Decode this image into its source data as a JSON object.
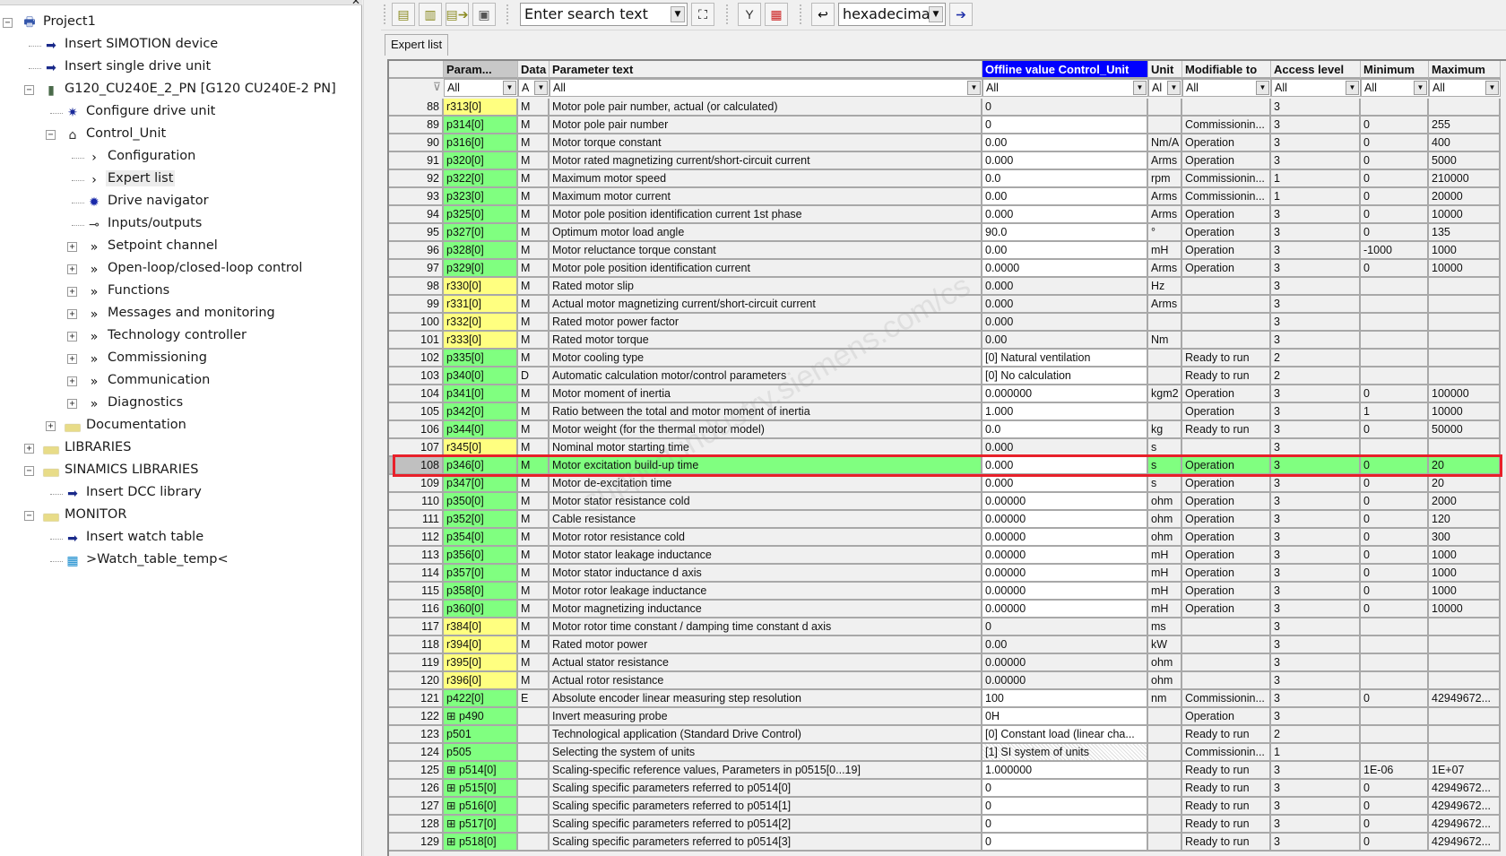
{
  "tree": [
    {
      "label": "Project1",
      "level": 0,
      "toggle": "minus",
      "icon": "project-icon"
    },
    {
      "label": "Insert SIMOTION device",
      "level": 1,
      "toggle": null,
      "icon": "insert-device-icon"
    },
    {
      "label": "Insert single drive unit",
      "level": 1,
      "toggle": null,
      "icon": "insert-device-icon"
    },
    {
      "label": "G120_CU240E_2_PN [G120 CU240E-2 PN]",
      "level": 1,
      "toggle": "minus",
      "icon": "drive-unit-icon"
    },
    {
      "label": "Configure drive unit",
      "level": 2,
      "toggle": null,
      "icon": "configure-gear-icon"
    },
    {
      "label": "Control_Unit",
      "level": 2,
      "toggle": "minus",
      "icon": "control-unit-icon"
    },
    {
      "label": "Configuration",
      "level": 3,
      "toggle": null,
      "icon": "chevron-right-icon"
    },
    {
      "label": "Expert list",
      "level": 3,
      "toggle": null,
      "icon": "chevron-right-icon",
      "selected": true
    },
    {
      "label": "Drive navigator",
      "level": 3,
      "toggle": null,
      "icon": "drive-navigator-icon"
    },
    {
      "label": "Inputs/outputs",
      "level": 3,
      "toggle": null,
      "icon": "inputs-outputs-icon"
    },
    {
      "label": "Setpoint channel",
      "level": 3,
      "toggle": "plus",
      "icon": "double-chevron-icon"
    },
    {
      "label": "Open-loop/closed-loop control",
      "level": 3,
      "toggle": "plus",
      "icon": "double-chevron-icon"
    },
    {
      "label": "Functions",
      "level": 3,
      "toggle": "plus",
      "icon": "double-chevron-icon"
    },
    {
      "label": "Messages and monitoring",
      "level": 3,
      "toggle": "plus",
      "icon": "double-chevron-icon"
    },
    {
      "label": "Technology controller",
      "level": 3,
      "toggle": "plus",
      "icon": "double-chevron-icon"
    },
    {
      "label": "Commissioning",
      "level": 3,
      "toggle": "plus",
      "icon": "double-chevron-icon"
    },
    {
      "label": "Communication",
      "level": 3,
      "toggle": "plus",
      "icon": "double-chevron-icon"
    },
    {
      "label": "Diagnostics",
      "level": 3,
      "toggle": "plus",
      "icon": "double-chevron-icon"
    },
    {
      "label": "Documentation",
      "level": 2,
      "toggle": "plus",
      "icon": "folder-icon"
    },
    {
      "label": "LIBRARIES",
      "level": 1,
      "toggle": "plus",
      "icon": "folder-icon"
    },
    {
      "label": "SINAMICS LIBRARIES",
      "level": 1,
      "toggle": "minus",
      "icon": "folder-icon"
    },
    {
      "label": "Insert DCC library",
      "level": 2,
      "toggle": null,
      "icon": "insert-device-icon"
    },
    {
      "label": "MONITOR",
      "level": 1,
      "toggle": "minus",
      "icon": "folder-icon"
    },
    {
      "label": "Insert watch table",
      "level": 2,
      "toggle": null,
      "icon": "insert-device-icon"
    },
    {
      "label": ">Watch_table_temp<",
      "level": 2,
      "toggle": null,
      "icon": "watch-table-icon"
    }
  ],
  "toolbar": {
    "search_placeholder": "Enter search text",
    "number_format": "hexadecima",
    "buttons": [
      "new-parameter-icon",
      "open-list-icon",
      "export-list-icon",
      "save-list-icon",
      "binoculars-icon",
      "filter-icon",
      "compare-icon",
      "back-arrow-icon",
      "go-icon"
    ]
  },
  "tab": "Expert list",
  "colors": {
    "readonly_param": "#ffff80",
    "writable_param": "#80ff80",
    "highlight_row": "#80ff80",
    "header_active": "#0000ff",
    "red_box": "#e8202a"
  },
  "columns": [
    "",
    "Param...",
    "Data",
    "Parameter text",
    "Offline value Control_Unit",
    "Unit",
    "Modifiable to",
    "Access level",
    "Minimum",
    "Maximum"
  ],
  "filters": [
    "",
    "All",
    "A",
    "All",
    "All",
    "Al",
    "All",
    "All",
    "All",
    "All"
  ],
  "rows": [
    {
      "n": "88",
      "param": "r313[0]",
      "data": "M",
      "text": "Motor pole pair number, actual (or calculated)",
      "value": "0",
      "unit": "",
      "mod": "",
      "access": "3",
      "min": "",
      "max": ""
    },
    {
      "n": "89",
      "param": "p314[0]",
      "data": "M",
      "text": "Motor pole pair number",
      "value": "0",
      "unit": "",
      "mod": "Commissionin...",
      "access": "3",
      "min": "0",
      "max": "255"
    },
    {
      "n": "90",
      "param": "p316[0]",
      "data": "M",
      "text": "Motor torque constant",
      "value": "0.00",
      "unit": "Nm/A",
      "mod": "Operation",
      "access": "3",
      "min": "0",
      "max": "400"
    },
    {
      "n": "91",
      "param": "p320[0]",
      "data": "M",
      "text": "Motor rated magnetizing current/short-circuit current",
      "value": "0.000",
      "unit": "Arms",
      "mod": "Operation",
      "access": "3",
      "min": "0",
      "max": "5000"
    },
    {
      "n": "92",
      "param": "p322[0]",
      "data": "M",
      "text": "Maximum motor speed",
      "value": "0.0",
      "unit": "rpm",
      "mod": "Commissionin...",
      "access": "1",
      "min": "0",
      "max": "210000"
    },
    {
      "n": "93",
      "param": "p323[0]",
      "data": "M",
      "text": "Maximum motor current",
      "value": "0.00",
      "unit": "Arms",
      "mod": "Commissionin...",
      "access": "1",
      "min": "0",
      "max": "20000"
    },
    {
      "n": "94",
      "param": "p325[0]",
      "data": "M",
      "text": "Motor pole position identification current 1st phase",
      "value": "0.000",
      "unit": "Arms",
      "mod": "Operation",
      "access": "3",
      "min": "0",
      "max": "10000"
    },
    {
      "n": "95",
      "param": "p327[0]",
      "data": "M",
      "text": "Optimum motor load angle",
      "value": "90.0",
      "unit": "°",
      "mod": "Operation",
      "access": "3",
      "min": "0",
      "max": "135"
    },
    {
      "n": "96",
      "param": "p328[0]",
      "data": "M",
      "text": "Motor reluctance torque constant",
      "value": "0.00",
      "unit": "mH",
      "mod": "Operation",
      "access": "3",
      "min": "-1000",
      "max": "1000"
    },
    {
      "n": "97",
      "param": "p329[0]",
      "data": "M",
      "text": "Motor pole position identification current",
      "value": "0.0000",
      "unit": "Arms",
      "mod": "Operation",
      "access": "3",
      "min": "0",
      "max": "10000"
    },
    {
      "n": "98",
      "param": "r330[0]",
      "data": "M",
      "text": "Rated motor slip",
      "value": "0.000",
      "unit": "Hz",
      "mod": "",
      "access": "3",
      "min": "",
      "max": ""
    },
    {
      "n": "99",
      "param": "r331[0]",
      "data": "M",
      "text": "Actual motor magnetizing current/short-circuit current",
      "value": "0.000",
      "unit": "Arms",
      "mod": "",
      "access": "3",
      "min": "",
      "max": ""
    },
    {
      "n": "100",
      "param": "r332[0]",
      "data": "M",
      "text": "Rated motor power factor",
      "value": "0.000",
      "unit": "",
      "mod": "",
      "access": "3",
      "min": "",
      "max": ""
    },
    {
      "n": "101",
      "param": "r333[0]",
      "data": "M",
      "text": "Rated motor torque",
      "value": "0.00",
      "unit": "Nm",
      "mod": "",
      "access": "3",
      "min": "",
      "max": ""
    },
    {
      "n": "102",
      "param": "p335[0]",
      "data": "M",
      "text": "Motor cooling type",
      "value": "[0] Natural ventilation",
      "unit": "",
      "mod": "Ready to run",
      "access": "2",
      "min": "",
      "max": ""
    },
    {
      "n": "103",
      "param": "p340[0]",
      "data": "D",
      "text": "Automatic calculation motor/control parameters",
      "value": "[0] No calculation",
      "unit": "",
      "mod": "Ready to run",
      "access": "2",
      "min": "",
      "max": ""
    },
    {
      "n": "104",
      "param": "p341[0]",
      "data": "M",
      "text": "Motor moment of inertia",
      "value": "0.000000",
      "unit": "kgm2",
      "mod": "Operation",
      "access": "3",
      "min": "0",
      "max": "100000"
    },
    {
      "n": "105",
      "param": "p342[0]",
      "data": "M",
      "text": "Ratio between the total and motor moment of inertia",
      "value": "1.000",
      "unit": "",
      "mod": "Operation",
      "access": "3",
      "min": "1",
      "max": "10000"
    },
    {
      "n": "106",
      "param": "p344[0]",
      "data": "M",
      "text": "Motor weight (for the thermal motor model)",
      "value": "0.0",
      "unit": "kg",
      "mod": "Ready to run",
      "access": "3",
      "min": "0",
      "max": "50000"
    },
    {
      "n": "107",
      "param": "r345[0]",
      "data": "M",
      "text": "Nominal motor starting time",
      "value": "0.000",
      "unit": "s",
      "mod": "",
      "access": "3",
      "min": "",
      "max": ""
    },
    {
      "n": "108",
      "param": "p346[0]",
      "data": "M",
      "text": "Motor excitation build-up time",
      "value": "0.000",
      "unit": "s",
      "mod": "Operation",
      "access": "3",
      "min": "0",
      "max": "20",
      "selected": true
    },
    {
      "n": "109",
      "param": "p347[0]",
      "data": "M",
      "text": "Motor de-excitation time",
      "value": "0.000",
      "unit": "s",
      "mod": "Operation",
      "access": "3",
      "min": "0",
      "max": "20"
    },
    {
      "n": "110",
      "param": "p350[0]",
      "data": "M",
      "text": "Motor stator resistance cold",
      "value": "0.00000",
      "unit": "ohm",
      "mod": "Operation",
      "access": "3",
      "min": "0",
      "max": "2000"
    },
    {
      "n": "111",
      "param": "p352[0]",
      "data": "M",
      "text": "Cable resistance",
      "value": "0.00000",
      "unit": "ohm",
      "mod": "Operation",
      "access": "3",
      "min": "0",
      "max": "120"
    },
    {
      "n": "112",
      "param": "p354[0]",
      "data": "M",
      "text": "Motor rotor resistance cold",
      "value": "0.00000",
      "unit": "ohm",
      "mod": "Operation",
      "access": "3",
      "min": "0",
      "max": "300"
    },
    {
      "n": "113",
      "param": "p356[0]",
      "data": "M",
      "text": "Motor stator leakage inductance",
      "value": "0.00000",
      "unit": "mH",
      "mod": "Operation",
      "access": "3",
      "min": "0",
      "max": "1000"
    },
    {
      "n": "114",
      "param": "p357[0]",
      "data": "M",
      "text": "Motor stator inductance d axis",
      "value": "0.00000",
      "unit": "mH",
      "mod": "Operation",
      "access": "3",
      "min": "0",
      "max": "1000"
    },
    {
      "n": "115",
      "param": "p358[0]",
      "data": "M",
      "text": "Motor rotor leakage inductance",
      "value": "0.00000",
      "unit": "mH",
      "mod": "Operation",
      "access": "3",
      "min": "0",
      "max": "1000"
    },
    {
      "n": "116",
      "param": "p360[0]",
      "data": "M",
      "text": "Motor magnetizing inductance",
      "value": "0.00000",
      "unit": "mH",
      "mod": "Operation",
      "access": "3",
      "min": "0",
      "max": "10000"
    },
    {
      "n": "117",
      "param": "r384[0]",
      "data": "M",
      "text": "Motor rotor time constant / damping time constant d axis",
      "value": "0",
      "unit": "ms",
      "mod": "",
      "access": "3",
      "min": "",
      "max": ""
    },
    {
      "n": "118",
      "param": "r394[0]",
      "data": "M",
      "text": "Rated motor power",
      "value": "0.00",
      "unit": "kW",
      "mod": "",
      "access": "3",
      "min": "",
      "max": ""
    },
    {
      "n": "119",
      "param": "r395[0]",
      "data": "M",
      "text": "Actual stator resistance",
      "value": "0.00000",
      "unit": "ohm",
      "mod": "",
      "access": "3",
      "min": "",
      "max": ""
    },
    {
      "n": "120",
      "param": "r396[0]",
      "data": "M",
      "text": "Actual rotor resistance",
      "value": "0.00000",
      "unit": "ohm",
      "mod": "",
      "access": "3",
      "min": "",
      "max": ""
    },
    {
      "n": "121",
      "param": "p422[0]",
      "data": "E",
      "text": "Absolute encoder linear measuring step resolution",
      "value": "100",
      "unit": "nm",
      "mod": "Commissionin...",
      "access": "3",
      "min": "0",
      "max": "42949672..."
    },
    {
      "n": "122",
      "param": "p490",
      "expand": true,
      "data": "",
      "text": "Invert measuring probe",
      "value": "0H",
      "unit": "",
      "mod": "Operation",
      "access": "3",
      "min": "",
      "max": ""
    },
    {
      "n": "123",
      "param": "p501",
      "data": "",
      "text": "Technological application (Standard Drive Control)",
      "value": "[0] Constant load (linear cha...",
      "unit": "",
      "mod": "Ready to run",
      "access": "2",
      "min": "",
      "max": ""
    },
    {
      "n": "124",
      "param": "p505",
      "data": "",
      "text": "Selecting the system of units",
      "value": "[1] SI system of units",
      "unit": "",
      "mod": "Commissionin...",
      "access": "1",
      "min": "",
      "max": "",
      "hatched": true
    },
    {
      "n": "125",
      "param": "p514[0]",
      "expand": true,
      "data": "",
      "text": "Scaling-specific reference values, Parameters in p0515[0...19]",
      "value": "1.000000",
      "unit": "",
      "mod": "Ready to run",
      "access": "3",
      "min": "1E-06",
      "max": "1E+07"
    },
    {
      "n": "126",
      "param": "p515[0]",
      "expand": true,
      "data": "",
      "text": "Scaling specific parameters referred to p0514[0]",
      "value": "0",
      "unit": "",
      "mod": "Ready to run",
      "access": "3",
      "min": "0",
      "max": "42949672..."
    },
    {
      "n": "127",
      "param": "p516[0]",
      "expand": true,
      "data": "",
      "text": "Scaling specific parameters referred to p0514[1]",
      "value": "0",
      "unit": "",
      "mod": "Ready to run",
      "access": "3",
      "min": "0",
      "max": "42949672..."
    },
    {
      "n": "128",
      "param": "p517[0]",
      "expand": true,
      "data": "",
      "text": "Scaling specific parameters referred to p0514[2]",
      "value": "0",
      "unit": "",
      "mod": "Ready to run",
      "access": "3",
      "min": "0",
      "max": "42949672..."
    },
    {
      "n": "129",
      "param": "p518[0]",
      "expand": true,
      "data": "",
      "text": "Scaling specific parameters referred to p0514[3]",
      "value": "0",
      "unit": "",
      "mod": "Ready to run",
      "access": "3",
      "min": "0",
      "max": "42949672..."
    }
  ]
}
